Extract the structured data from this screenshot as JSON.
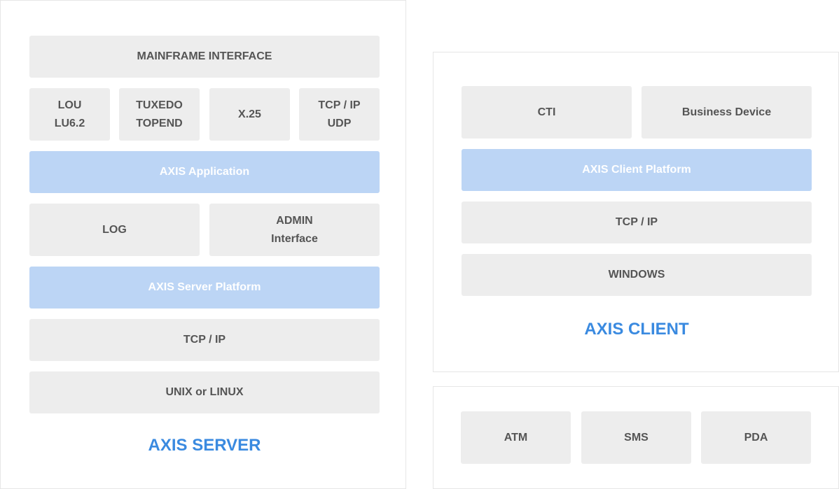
{
  "server": {
    "mainframe": "MAINFRAME INTERFACE",
    "lou": [
      "LOU",
      "LU6.2"
    ],
    "tuxedo": [
      "TUXEDO",
      "TOPEND"
    ],
    "x25": "X.25",
    "tcpudp": [
      "TCP / IP",
      "UDP"
    ],
    "application": "AXIS Application",
    "log": "LOG",
    "admin": [
      "ADMIN",
      "Interface"
    ],
    "platform": "AXIS Server Platform",
    "tcpip": "TCP / IP",
    "os": "UNIX or LINUX",
    "title": "AXIS SERVER"
  },
  "client": {
    "cti": "CTI",
    "business": "Business Device",
    "platform": "AXIS Client Platform",
    "tcpip": "TCP / IP",
    "os": "WINDOWS",
    "title": "AXIS CLIENT"
  },
  "devices": {
    "atm": "ATM",
    "sms": "SMS",
    "pda": "PDA"
  },
  "colors": {
    "accent": "#3a8ae0",
    "layer_gray": "#ededed",
    "layer_blue": "#bcd5f5"
  }
}
